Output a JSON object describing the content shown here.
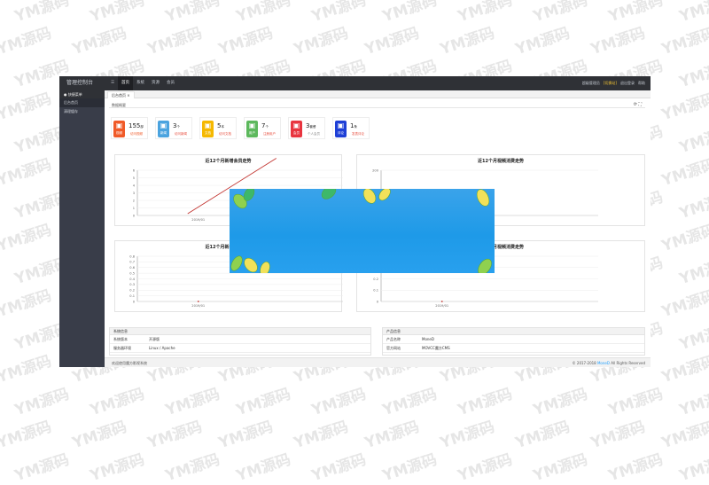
{
  "watermark": "YM源码",
  "topbar": {
    "brand": "管理控制台",
    "nav": [
      "首页",
      "系统",
      "资源",
      "会员"
    ],
    "right": [
      "超级管理员",
      "[切换站]",
      "退出登录",
      "帮助"
    ]
  },
  "sidebar": {
    "heading": "快捷菜单",
    "items": [
      "后台首页",
      "清理缓存"
    ]
  },
  "tab": "后台首页",
  "panel_title": "数据概要",
  "cards": [
    {
      "icon": "视频",
      "num": "155",
      "unit": "部",
      "label": "访问视频",
      "color": "#f05a28",
      "label_color": "#f05a28"
    },
    {
      "icon": "新闻",
      "num": "3",
      "unit": "个",
      "label": "访问新闻",
      "color": "#4aa3df",
      "label_color": "#e74c3c"
    },
    {
      "icon": "文档",
      "num": "5",
      "unit": "本",
      "label": "访问文档",
      "color": "#f5b800",
      "label_color": "#e74c3c"
    },
    {
      "icon": "用户",
      "num": "7",
      "unit": "个",
      "label": "注册用户",
      "color": "#5cb85c",
      "label_color": "#e74c3c"
    },
    {
      "icon": "会员",
      "num": "3",
      "unit": "套餐",
      "label": "个人会员",
      "color": "#e8343f",
      "label_color": "#888888"
    },
    {
      "icon": "评论",
      "num": "1",
      "unit": "条",
      "label": "发表评论",
      "color": "#1e3fd6",
      "label_color": "#e74c3c"
    }
  ],
  "chart_titles": [
    "近12个月新增会员走势",
    "近12个月视频消费走势",
    "近12个月新增会员走势",
    "近12个月视频消费走势"
  ],
  "chart_data": [
    {
      "type": "line",
      "title": "近12个月新增会员走势",
      "categories": [
        "2019/01"
      ],
      "series": [
        {
          "values": [
            5
          ]
        }
      ],
      "ylim": [
        0,
        6
      ],
      "yticks": [
        0,
        1,
        2,
        3,
        4,
        5,
        6
      ]
    },
    {
      "type": "line",
      "title": "近12个月视频消费走势",
      "categories": [
        "2019/01"
      ],
      "series": [
        {
          "values": [
            0
          ]
        }
      ],
      "ylim": [
        0,
        200
      ],
      "yticks": [
        0,
        200
      ]
    },
    {
      "type": "line",
      "title": "",
      "categories": [
        "2019/01"
      ],
      "series": [
        {
          "values": [
            0
          ]
        }
      ],
      "ylim": [
        0,
        0.8
      ],
      "yticks": [
        0,
        0.1,
        0.2,
        0.3,
        0.4,
        0.5,
        0.6,
        0.7,
        0.8
      ]
    },
    {
      "type": "line",
      "title": "",
      "categories": [
        "2019/01"
      ],
      "series": [
        {
          "values": [
            0
          ]
        }
      ],
      "ylim": [
        0,
        0.4
      ],
      "yticks": [
        0,
        0.1,
        0.2,
        0.3,
        0.4
      ]
    }
  ],
  "sysinfo": {
    "title": "系统信息",
    "rows": [
      {
        "k": "系统版本",
        "v": "开源版"
      },
      {
        "k": "服务器环境",
        "v": "Linux / Apache"
      }
    ]
  },
  "productinfo": {
    "title": "产品信息",
    "rows": [
      {
        "k": "产品名称",
        "v": "MoneD"
      },
      {
        "k": "官方网站",
        "v": "MOVCC魔方CMS"
      }
    ]
  },
  "footer": {
    "left": "欢迎使用魔方影视系统",
    "right_prefix": "© 2017-2018",
    "right_link": "MoneD",
    "right_suffix": "All Rights Reserved"
  },
  "colors": {
    "line": "#c23531",
    "accent": "#1e9fff",
    "overlay": "#1e9ae8"
  }
}
